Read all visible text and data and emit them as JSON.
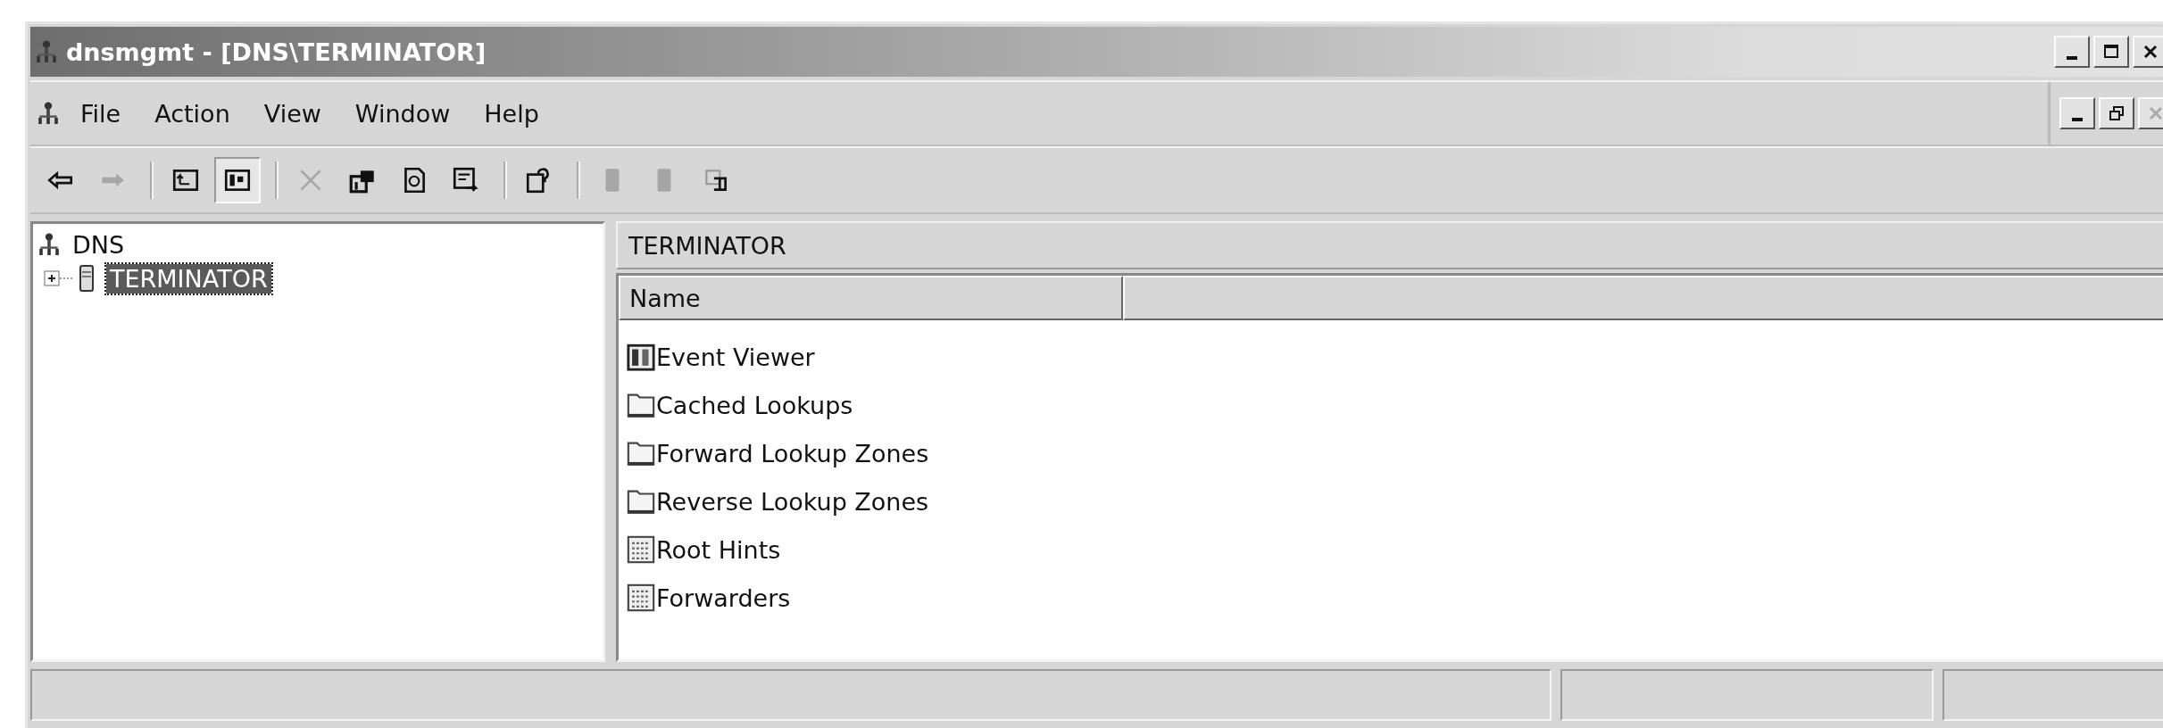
{
  "window": {
    "title": "dnsmgmt - [DNS\\TERMINATOR]"
  },
  "menu": [
    "File",
    "Action",
    "View",
    "Window",
    "Help"
  ],
  "toolbar": [
    {
      "kind": "back",
      "disabled": false
    },
    {
      "kind": "forward",
      "disabled": true
    },
    {
      "kind": "sep"
    },
    {
      "kind": "up",
      "disabled": false
    },
    {
      "kind": "tree",
      "disabled": false,
      "selected": true
    },
    {
      "kind": "sep"
    },
    {
      "kind": "delete",
      "disabled": true
    },
    {
      "kind": "properties",
      "disabled": false
    },
    {
      "kind": "refresh",
      "disabled": false
    },
    {
      "kind": "export",
      "disabled": false
    },
    {
      "kind": "sep"
    },
    {
      "kind": "help",
      "disabled": false
    },
    {
      "kind": "sep"
    },
    {
      "kind": "server",
      "disabled": true
    },
    {
      "kind": "server",
      "disabled": true
    },
    {
      "kind": "copy",
      "disabled": false
    }
  ],
  "tree": {
    "label": "DNS",
    "children": [
      {
        "label": "TERMINATOR",
        "expanded": false,
        "selected": true
      }
    ]
  },
  "details": {
    "header": "TERMINATOR",
    "columns": [
      "Name"
    ],
    "rows": [
      {
        "name": "Event Viewer",
        "kind": "log"
      },
      {
        "name": "Cached Lookups",
        "kind": "folder"
      },
      {
        "name": "Forward Lookup Zones",
        "kind": "folder"
      },
      {
        "name": "Reverse Lookup Zones",
        "kind": "folder"
      },
      {
        "name": "Root Hints",
        "kind": "hints"
      },
      {
        "name": "Forwarders",
        "kind": "hints"
      }
    ]
  }
}
